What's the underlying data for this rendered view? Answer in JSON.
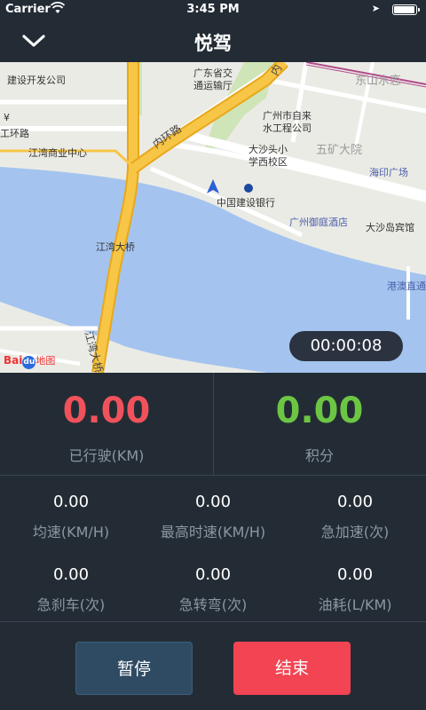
{
  "status_bar": {
    "carrier": "Carrier",
    "time": "3:45 PM",
    "battery_level": 1.0
  },
  "nav": {
    "title": "悦驾",
    "back_icon": "chevron-down-icon"
  },
  "map": {
    "labels": {
      "jianshe": "建设开发公司",
      "guangdong": "广东省交",
      "guangdong2": "通运输厅",
      "dongshan": "东山水恋",
      "water": "广州市自来",
      "water2": "水工程公司",
      "ring": "内环路",
      "ring2": "内",
      "ring_left": "工环路",
      "jiangwan_biz": "江湾商业中心",
      "school": "大沙头小",
      "school2": "学西校区",
      "wukuang": "五矿大院",
      "haiyin": "海印广场",
      "ccb": "中国建设银行",
      "yuting": "广州御庭酒店",
      "dashatou_hotel": "大沙岛宾馆",
      "bridge": "江湾大桥",
      "bridge_road": "江湾大桥",
      "ganghao": "港澳直通",
      "yen": "¥",
      "ring_bottom": "内"
    },
    "logo_text": "Bai",
    "logo_du": "du",
    "logo_map": "地图",
    "timer": "00:00:08"
  },
  "stats": {
    "distance": {
      "value": "0.00",
      "label": "已行驶(KM)",
      "color": "#f0525c"
    },
    "points": {
      "value": "0.00",
      "label": "积分",
      "color": "#6cc644"
    }
  },
  "grid": [
    {
      "value": "0.00",
      "label": "均速(KM/H)"
    },
    {
      "value": "0.00",
      "label": "最高时速(KM/H)"
    },
    {
      "value": "0.00",
      "label": "急加速(次)"
    },
    {
      "value": "0.00",
      "label": "急刹车(次)"
    },
    {
      "value": "0.00",
      "label": "急转弯(次)"
    },
    {
      "value": "0.00",
      "label": "油耗(L/KM)"
    }
  ],
  "buttons": {
    "pause": "暂停",
    "end": "结束"
  }
}
